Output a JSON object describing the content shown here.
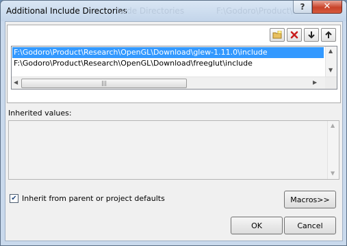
{
  "window": {
    "title": "Additional Include Directories"
  },
  "title_buttons": {
    "help": "?",
    "close": "✕"
  },
  "toolbar": {
    "new_line": "new-folder-icon",
    "delete": "delete-icon",
    "move_down": "arrow-down-icon",
    "move_up": "arrow-up-icon"
  },
  "directories": [
    {
      "path": "F:\\Godoro\\Product\\Research\\OpenGL\\Download\\glew-1.11.0\\include",
      "selected": true
    },
    {
      "path": "F:\\Godoro\\Product\\Research\\OpenGL\\Download\\freeglut\\include",
      "selected": false
    }
  ],
  "inherited": {
    "label": "Inherited values:"
  },
  "inherit_checkbox": {
    "label": "Inherit from parent or project defaults",
    "checked": true
  },
  "buttons": {
    "macros": "Macros>>",
    "ok": "OK",
    "cancel": "Cancel"
  }
}
